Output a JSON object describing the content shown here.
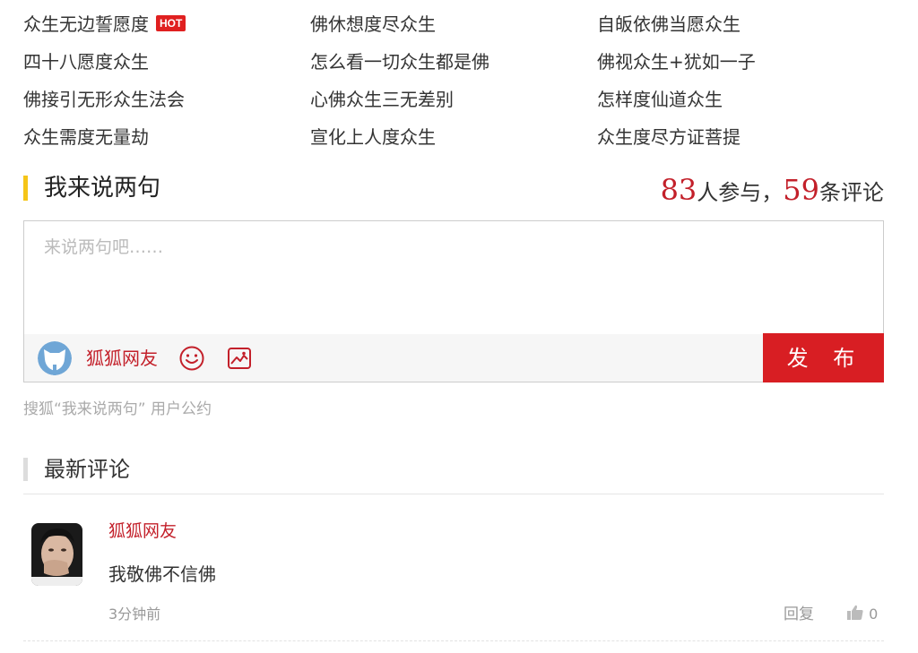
{
  "related_links": [
    {
      "label": "众生无边誓愿度",
      "badge": "HOT"
    },
    {
      "label": "佛休想度尽众生"
    },
    {
      "label": "自皈依佛当愿众生"
    },
    {
      "label": "四十八愿度众生"
    },
    {
      "label": "怎么看一切众生都是佛"
    },
    {
      "label": "佛视众生+犹如一子"
    },
    {
      "label": "佛接引无形众生法会"
    },
    {
      "label": "心佛众生三无差别"
    },
    {
      "label": "怎样度仙道众生"
    },
    {
      "label": "众生需度无量劫"
    },
    {
      "label": "宣化上人度众生"
    },
    {
      "label": "众生度尽方证菩提"
    }
  ],
  "comment_section": {
    "title": "我来说两句",
    "participants": "83",
    "participants_label": "人参与，",
    "comments": "59",
    "comments_label": "条评论"
  },
  "composer": {
    "placeholder": "来说两句吧……",
    "username": "狐狐网友",
    "publish_label": "发 布",
    "agreement": "搜狐“我来说两句” 用户公约"
  },
  "latest": {
    "title": "最新评论",
    "comments": [
      {
        "user": "狐狐网友",
        "text": "我敬佛不信佛",
        "time": "3分钟前",
        "reply_label": "回复",
        "likes": "0"
      }
    ]
  },
  "colors": {
    "accent_red": "#d81e23",
    "section_bar": "#f5c518"
  },
  "icons": [
    "emoji-icon",
    "image-icon",
    "thumb-up-icon",
    "default-avatar-icon"
  ]
}
